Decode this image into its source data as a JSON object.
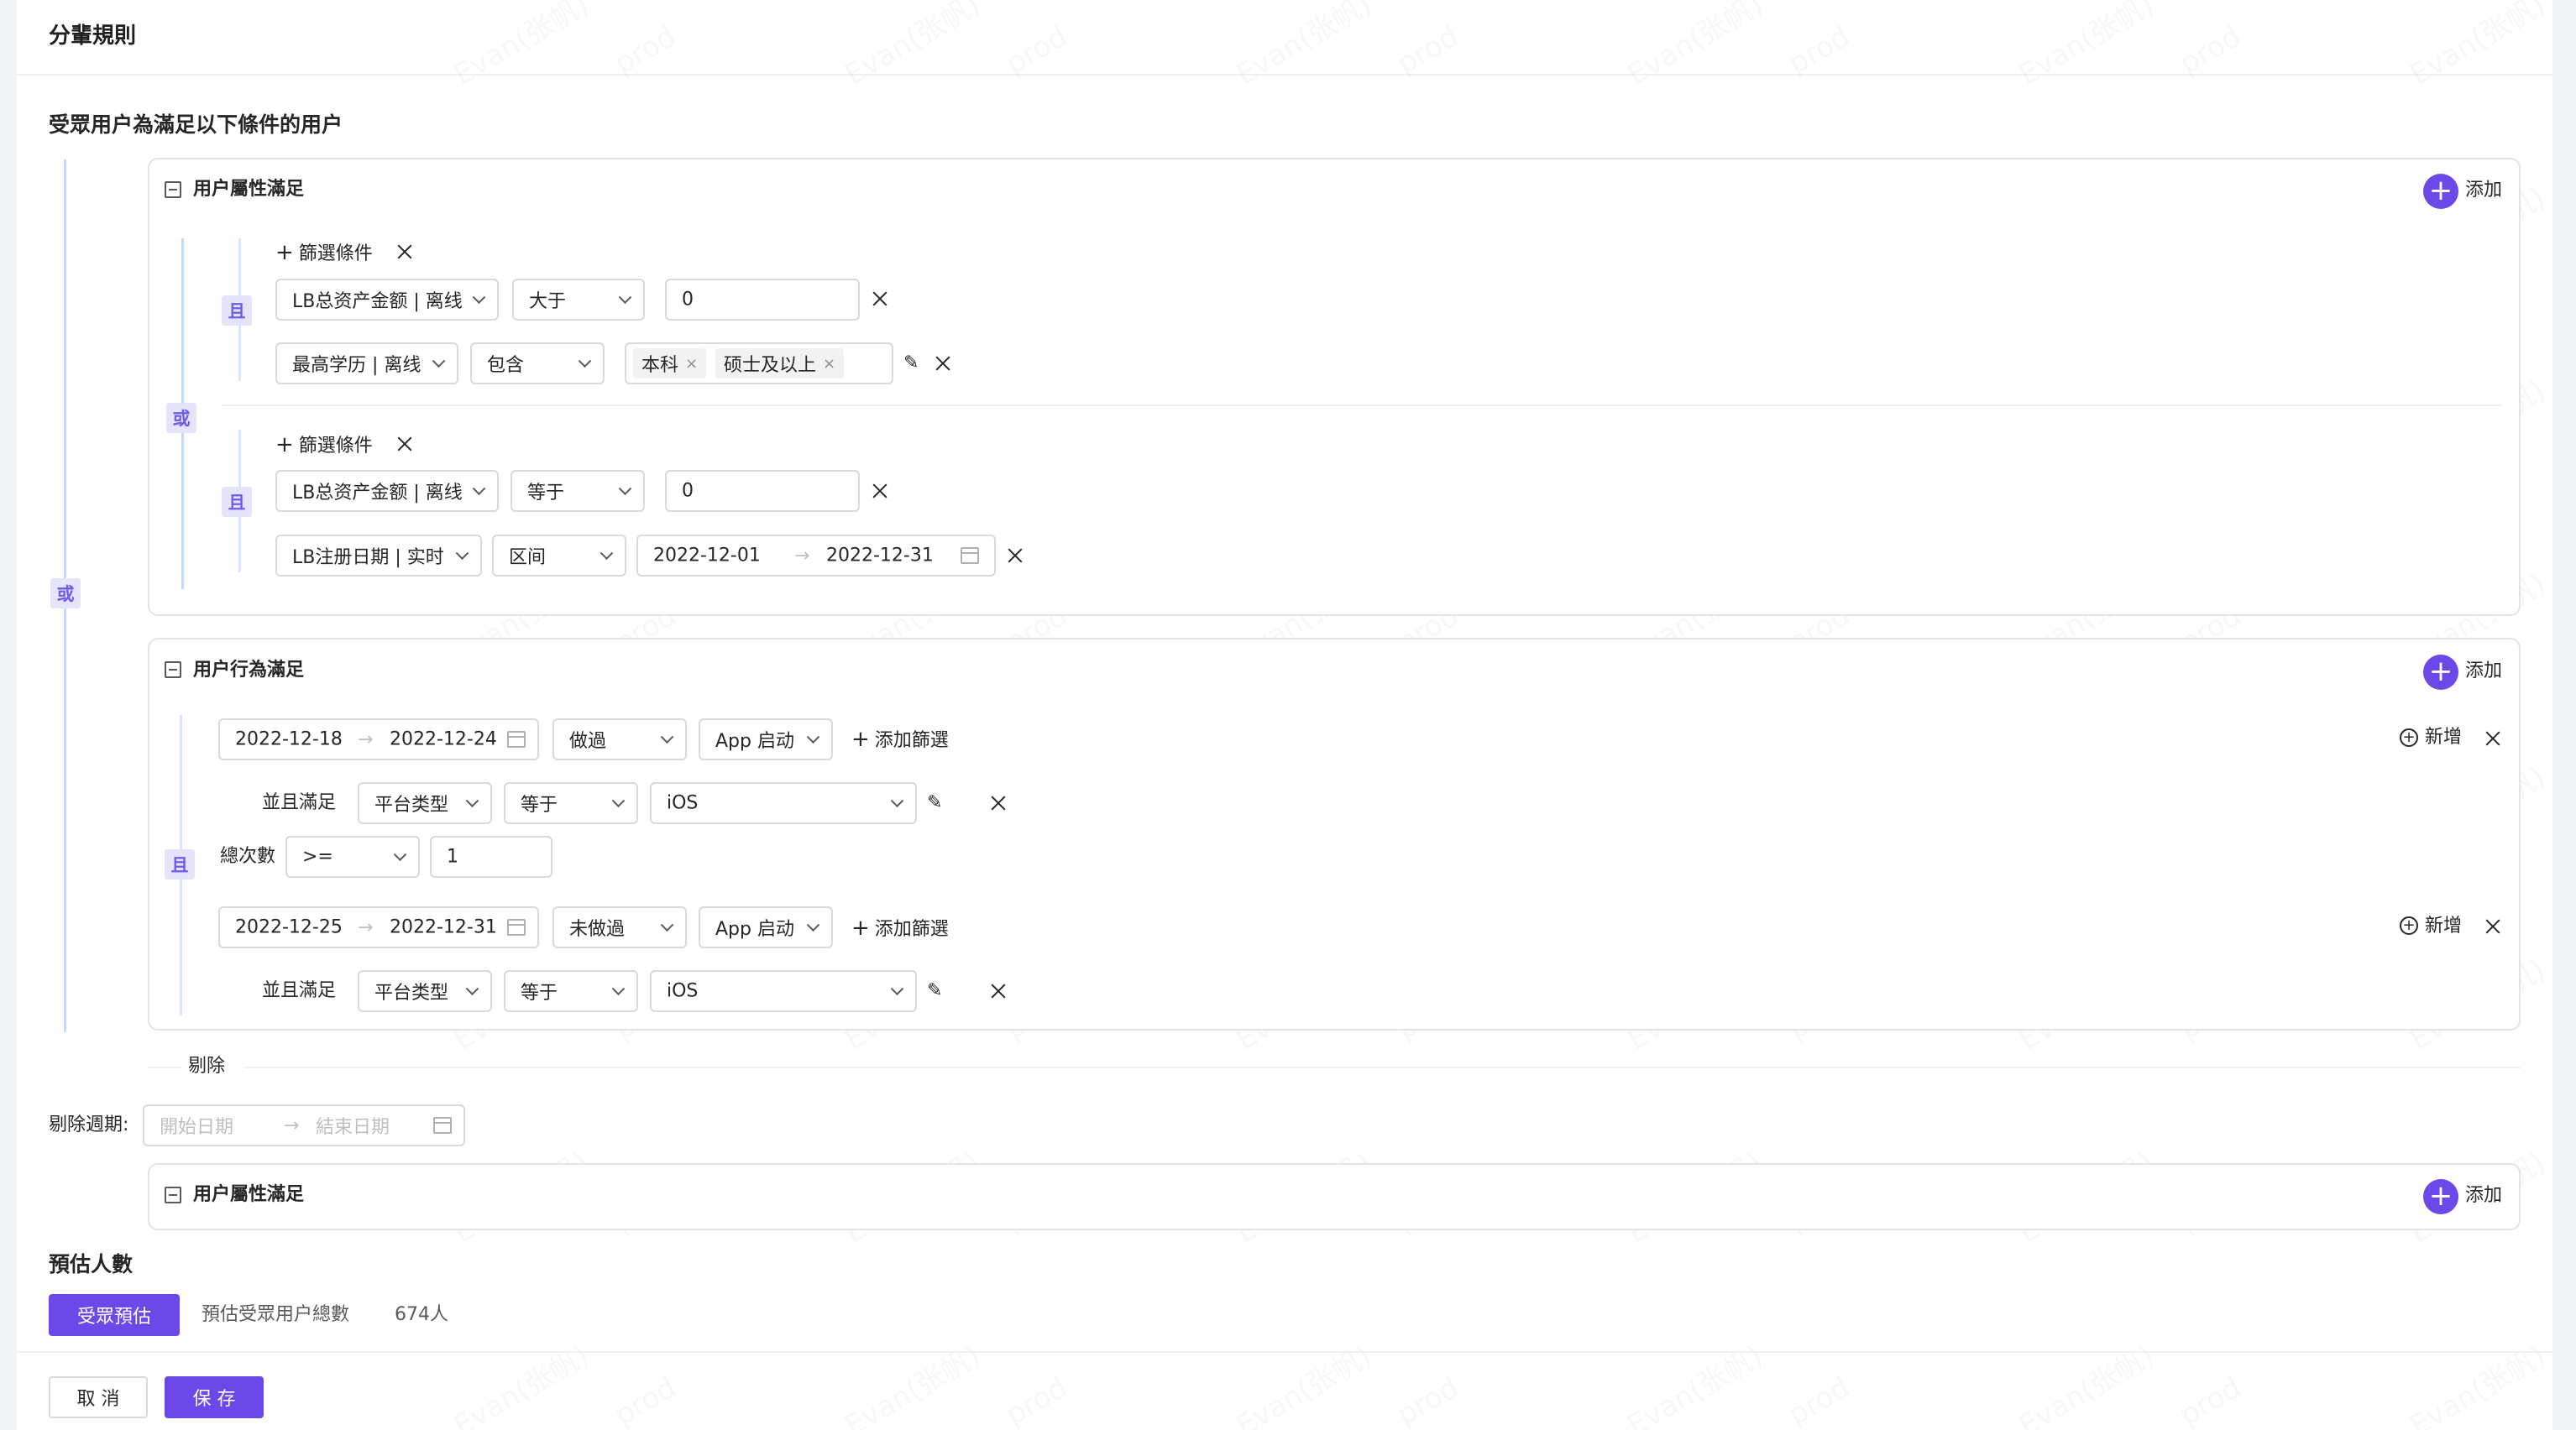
{
  "page": {
    "title": "分輩規則"
  },
  "audience": {
    "heading": "受眾用户為滿足以下條件的用户",
    "outer_relation": "或"
  },
  "attr_block": {
    "title": "用户屬性滿足",
    "add_label": "添加",
    "inner_relation": "或",
    "groups": [
      {
        "relation": "且",
        "filter_label": "篩選條件",
        "rows": [
          {
            "field": "LB总资产金额 | 离线",
            "operator": "大于",
            "value": "0"
          },
          {
            "field": "最高学历 | 离线",
            "operator": "包含",
            "tags": [
              "本科",
              "硕士及以上"
            ]
          }
        ]
      },
      {
        "relation": "且",
        "filter_label": "篩選條件",
        "rows": [
          {
            "field": "LB总资产金额 | 离线",
            "operator": "等于",
            "value": "0"
          },
          {
            "field": "LB注册日期 | 实时",
            "operator": "区间",
            "start": "2022-12-01",
            "end": "2022-12-31"
          }
        ]
      }
    ]
  },
  "behavior_block": {
    "title": "用户行為滿足",
    "add_label": "添加",
    "relation": "且",
    "rules": [
      {
        "start": "2022-12-18",
        "end": "2022-12-24",
        "did": "做過",
        "event": "App 启动",
        "add_filter": "添加篩選",
        "new_label": "新增",
        "sub_label": "並且滿足",
        "sub_field": "平台类型",
        "sub_op": "等于",
        "sub_value": "iOS"
      },
      {
        "start": "2022-12-25",
        "end": "2022-12-31",
        "did": "未做過",
        "event": "App 启动",
        "add_filter": "添加篩選",
        "new_label": "新增",
        "sub_label": "並且滿足",
        "sub_field": "平台类型",
        "sub_op": "等于",
        "sub_value": "iOS"
      }
    ],
    "total_label": "總次數",
    "total_op": ">=",
    "total_value": "1"
  },
  "exclude": {
    "label": "剔除",
    "period_label": "剔除週期:",
    "start_placeholder": "開始日期",
    "end_placeholder": "結束日期",
    "block_title": "用户屬性滿足",
    "add_label": "添加"
  },
  "estimate": {
    "heading": "預估人數",
    "button": "受眾預估",
    "total_label": "預估受眾用户總數",
    "total_value": "674人"
  },
  "footer": {
    "cancel": "取 消",
    "save": "保 存"
  },
  "watermark": {
    "name": "Evan(张帆)",
    "env": "prod"
  },
  "colors": {
    "primary": "#6b48e8",
    "relation_bg": "#e6e4fb",
    "line": "#c7d9f7"
  }
}
